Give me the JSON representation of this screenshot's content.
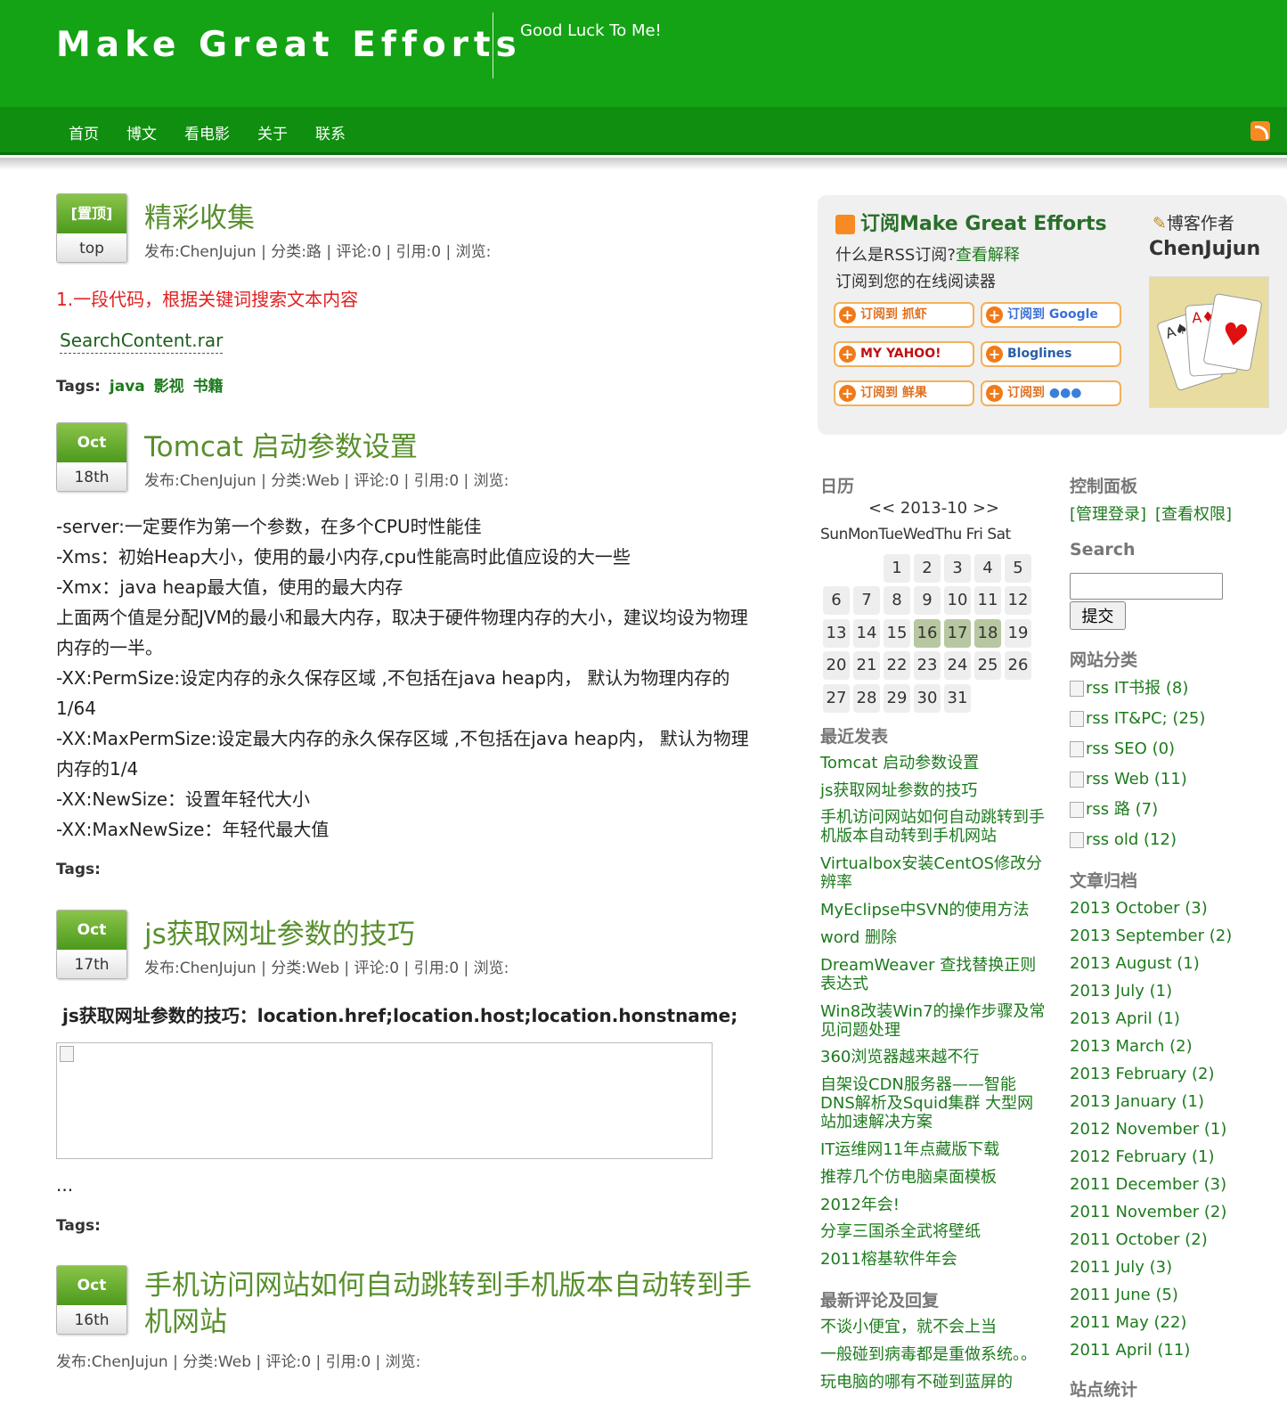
{
  "site": {
    "title": "Make Great Efforts",
    "tagline": "Good Luck To Me!"
  },
  "nav": [
    "首页",
    "博文",
    "看电影",
    "关于",
    "联系"
  ],
  "posts": [
    {
      "date_top": "[置顶]",
      "date_bottom": "top",
      "title": "精彩收集",
      "meta": "发布:ChenJujun | 分类:路 | 评论:0 | 引用:0 | 浏览:",
      "body": [
        "1.一段代码，根据关键词搜索文本内容"
      ],
      "attachment": "SearchContent.rar",
      "tags_label": "Tags:",
      "tags": [
        "java",
        "影视",
        "书籍"
      ]
    },
    {
      "date_top": "Oct",
      "date_bottom": "18th",
      "title": "Tomcat 启动参数设置",
      "meta": "发布:ChenJujun | 分类:Web | 评论:0 | 引用:0 | 浏览:",
      "body": [
        "-server:一定要作为第一个参数，在多个CPU时性能佳",
        "-Xms：初始Heap大小，使用的最小内存,cpu性能高时此值应设的大一些",
        "-Xmx：java heap最大值，使用的最大内存",
        "上面两个值是分配JVM的最小和最大内存，取决于硬件物理内存的大小，建议均设为物理",
        "内存的一半。",
        "-XX:PermSize:设定内存的永久保存区域 ,不包括在java heap内， 默认为物理内存的",
        "1/64",
        "-XX:MaxPermSize:设定最大内存的永久保存区域 ,不包括在java heap内， 默认为物理",
        "内存的1/4",
        "-XX:NewSize：设置年轻代大小",
        "-XX:MaxNewSize：年轻代最大值"
      ],
      "tags_label": "Tags:"
    },
    {
      "date_top": "Oct",
      "date_bottom": "17th",
      "title": "js获取网址参数的技巧",
      "meta": "发布:ChenJujun | 分类:Web | 评论:0 | 引用:0 | 浏览:",
      "body": [
        "js获取网址参数的技巧：location.href;location.host;location.honstname;"
      ],
      "ellipsis": "...",
      "tags_label": "Tags:"
    },
    {
      "date_top": "Oct",
      "date_bottom": "16th",
      "title_lines": [
        "手机访问网站如何自动跳转到手机版本自动转到手",
        "机网站"
      ],
      "meta": "发布:ChenJujun | 分类:Web | 评论:0 | 引用:0 | 浏览:"
    }
  ],
  "subscribe": {
    "title": "订阅Make Great Efforts",
    "q": "什么是RSS订阅?",
    "explain": "查看解释",
    "line2": "订阅到您的在线阅读器",
    "buttons": [
      "订阅到 抓虾",
      "订阅到 Google",
      "MY YAHOO!",
      "Bloglines",
      "订阅到 鲜果",
      "订阅到 "
    ]
  },
  "author": {
    "label": "博客作者",
    "name": "ChenJujun"
  },
  "calendar": {
    "heading": "日历",
    "nav": "<< 2013-10 >>",
    "weekdays": [
      "Sun",
      "Mon",
      "Tue",
      "Wed",
      "Thu",
      "Fri",
      "Sat"
    ],
    "days": [
      "1",
      "2",
      "3",
      "4",
      "5",
      "6",
      "7",
      "8",
      "9",
      "10",
      "11",
      "12",
      "13",
      "14",
      "15",
      "16",
      "17",
      "18",
      "19",
      "20",
      "21",
      "22",
      "23",
      "24",
      "25",
      "26",
      "27",
      "28",
      "29",
      "30",
      "31"
    ],
    "highlight": [
      "16",
      "17",
      "18"
    ]
  },
  "recent": {
    "heading": "最近发表",
    "items": [
      "Tomcat 启动参数设置",
      "js获取网址参数的技巧",
      "手机访问网站如何自动跳转到手机版本自动转到手机网站",
      "Virtualbox安装CentOS修改分辨率",
      "MyEclipse中SVN的使用方法",
      "word 删除",
      "DreamWeaver 查找替换正则表达式",
      "Win8改装Win7的操作步骤及常见问题处理",
      "360浏览器越来越不行",
      "自架设CDN服务器——智能DNS解析及Squid集群 大型网站加速解决方案",
      "IT运维网11年点藏版下载",
      "推荐几个仿电脑桌面模板",
      "2012年会!",
      "分享三国杀全武将壁纸",
      "2011榕基软件年会"
    ]
  },
  "comments": {
    "heading": "最新评论及回复",
    "items": [
      "不谈小便宜，就不会上当",
      "一般碰到病毒都是重做系统。。",
      "玩电脑的哪有不碰到蓝屏的"
    ]
  },
  "control": {
    "heading": "控制面板",
    "login": "[管理登录]",
    "perm": "[查看权限]"
  },
  "search": {
    "heading": "Search",
    "submit": "提交",
    "value": ""
  },
  "categories": {
    "heading": "网站分类",
    "items": [
      "rss IT书报 (8)",
      "rss IT&PC; (25)",
      "rss SEO (0)",
      "rss Web (11)",
      "rss 路 (7)",
      "rss old (12)"
    ]
  },
  "archives": {
    "heading": "文章归档",
    "items": [
      "2013 October (3)",
      "2013 September (2)",
      "2013 August (1)",
      "2013 July (1)",
      "2013 April (1)",
      "2013 March (2)",
      "2013 February (2)",
      "2013 January (1)",
      "2012 November (1)",
      "2012 February (1)",
      "2011 December (3)",
      "2011 November (2)",
      "2011 October (2)",
      "2011 July (3)",
      "2011 June (5)",
      "2011 May (22)",
      "2011 April (11)"
    ]
  },
  "stats": {
    "heading": "站点统计"
  },
  "colors": {
    "header": "#14a314",
    "nav": "#0f8e0f",
    "link": "#1d7a1d",
    "title": "#578f2c",
    "red": "#e02020"
  }
}
